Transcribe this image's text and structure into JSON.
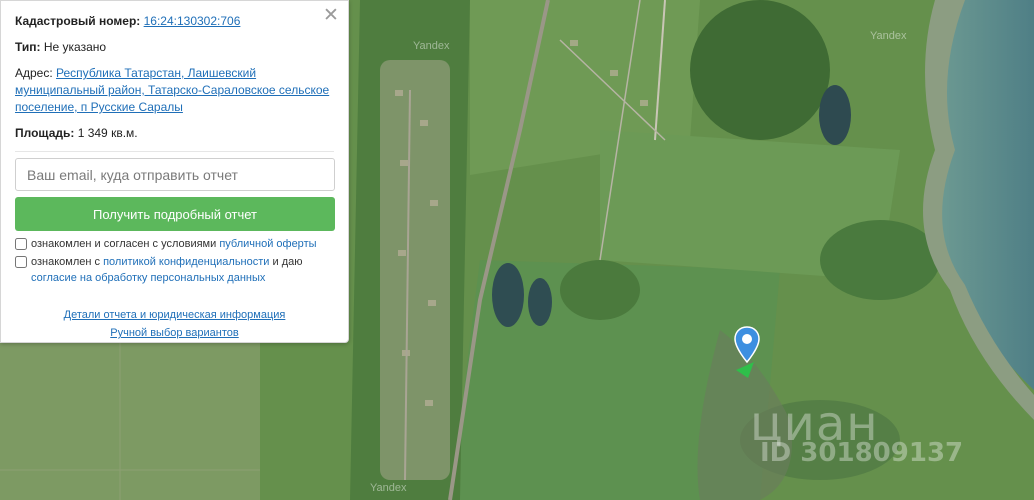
{
  "panel": {
    "cadastral_label": "Кадастровый номер:",
    "cadastral_value": "16:24:130302:706",
    "type_label": "Тип:",
    "type_value": "Не указано",
    "address_label": "Адрес:",
    "address_value": "Республика Татарстан, Лаишевский муниципальный район, Татарско-Сараловское сельское поселение, п Русские Саралы",
    "area_label": "Площадь:",
    "area_value": "1 349 кв.м.",
    "email_placeholder": "Ваш email, куда отправить отчет",
    "get_report_button": "Получить подробный отчет",
    "consent_offer_prefix": "ознакомлен и согласен с условиями",
    "consent_offer_link": "публичной оферты",
    "consent_privacy_prefix": "ознакомлен с",
    "consent_privacy_link": "политикой конфиденциальности",
    "consent_privacy_mid": "и даю",
    "consent_data_link": "согласие на обработку персональных данных",
    "details_link": "Детали отчета и юридическая информация",
    "manual_link": "Ручной выбор вариантов",
    "close_icon": "close-icon"
  },
  "map": {
    "provider_watermark": "Yandex",
    "listing_watermark": "циан",
    "listing_id": "ID 301809137",
    "marker_icon": "location-pin-icon",
    "accent_color": "#3d8fe0",
    "pointer_color": "#2fbf4a"
  }
}
